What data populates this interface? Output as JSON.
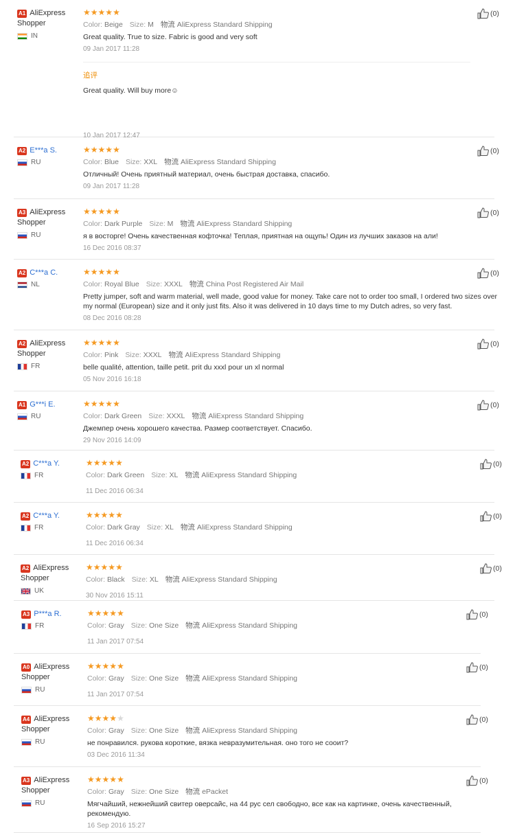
{
  "labels": {
    "color": "Color:",
    "size": "Size:",
    "shipping": "物流",
    "followup": "追评"
  },
  "icons": {
    "star": "star-icon",
    "thumb": "thumbs-up-icon",
    "flag": "flag-icon"
  },
  "colors": {
    "star": "#f59a23",
    "badge": "#d9361e",
    "masked_name": "#2d6fd2",
    "followup": "#ee8b00"
  },
  "reviews": [
    {
      "level": "A1",
      "name": "AliExpress Shopper",
      "masked": false,
      "country": "IN",
      "stars": 5,
      "color": "Beige",
      "size": "M",
      "shipping": "AliExpress Standard Shipping",
      "text": "Great quality. True to size. Fabric is good and very soft",
      "date": "09 Jan 2017 11:28",
      "helpful": "(0)",
      "followup": {
        "text": "Great quality. Will buy more☺",
        "date": "10 Jan 2017 12:47"
      }
    },
    {
      "level": "A2",
      "name": "E***a S.",
      "masked": true,
      "country": "RU",
      "stars": 5,
      "color": "Blue",
      "size": "XXL",
      "shipping": "AliExpress Standard Shipping",
      "text": "Отличный! Очень приятный материал, очень быстрая доставка, спасибо.",
      "date": "09 Jan 2017 11:28",
      "helpful": "(0)"
    },
    {
      "level": "A3",
      "name": "AliExpress Shopper",
      "masked": false,
      "country": "RU",
      "stars": 5,
      "color": "Dark Purple",
      "size": "M",
      "shipping": "AliExpress Standard Shipping",
      "text": "я в восторге! Очень качественная кофточка! Теплая, приятная на ощупь! Один из лучших заказов на али!",
      "date": "16 Dec 2016 08:37",
      "helpful": "(0)"
    },
    {
      "level": "A2",
      "name": "C***a C.",
      "masked": true,
      "country": "NL",
      "stars": 5,
      "color": "Royal Blue",
      "size": "XXXL",
      "shipping": "China Post Registered Air Mail",
      "text": "Pretty jumper, soft and warm material, well made, good value for money. Take care not to order too small, I ordered two sizes over my normal (European) size and it only just fits. Also it was delivered in 10 days time to my Dutch adres, so very fast.",
      "date": "08 Dec 2016 08:28",
      "helpful": "(0)"
    },
    {
      "level": "A2",
      "name": "AliExpress Shopper",
      "masked": false,
      "country": "FR",
      "stars": 5,
      "color": "Pink",
      "size": "XXXL",
      "shipping": "AliExpress Standard Shipping",
      "text": "belle qualité, attention, taille petit. prit du xxxl pour un xl normal",
      "date": "05 Nov 2016 16:18",
      "helpful": "(0)"
    },
    {
      "level": "A1",
      "name": "G***i E.",
      "masked": true,
      "country": "RU",
      "stars": 5,
      "color": "Dark Green",
      "size": "XXXL",
      "shipping": "AliExpress Standard Shipping",
      "text": "Джемпер очень хорошего качества. Размер соответствует. Спасибо.",
      "date": "29 Nov 2016 14:09",
      "helpful": "(0)"
    },
    {
      "level": "A2",
      "name": "C***a Y.",
      "masked": true,
      "country": "FR",
      "stars": 5,
      "color": "Dark Green",
      "size": "XL",
      "shipping": "AliExpress Standard Shipping",
      "text": "",
      "date": "11 Dec 2016 06:34",
      "helpful": "(0)"
    },
    {
      "level": "A2",
      "name": "C***a Y.",
      "masked": true,
      "country": "FR",
      "stars": 5,
      "color": "Dark Gray",
      "size": "XL",
      "shipping": "AliExpress Standard Shipping",
      "text": "",
      "date": "11 Dec 2016 06:34",
      "helpful": "(0)"
    },
    {
      "level": "A2",
      "name": "AliExpress Shopper",
      "masked": false,
      "country": "UK",
      "stars": 5,
      "color": "Black",
      "size": "XL",
      "shipping": "AliExpress Standard Shipping",
      "text": "",
      "date": "30 Nov 2016 15:11",
      "helpful": "(0)"
    },
    {
      "level": "A3",
      "name": "P***a R.",
      "masked": true,
      "country": "FR",
      "stars": 5,
      "color": "Gray",
      "size": "One Size",
      "shipping": "AliExpress Standard Shipping",
      "text": "",
      "date": "11 Jan 2017 07:54",
      "helpful": "(0)"
    },
    {
      "level": "A0",
      "name": "AliExpress Shopper",
      "masked": false,
      "country": "RU",
      "stars": 5,
      "color": "Gray",
      "size": "One Size",
      "shipping": "AliExpress Standard Shipping",
      "text": "",
      "date": "11 Jan 2017 07:54",
      "helpful": "(0)"
    },
    {
      "level": "A4",
      "name": "AliExpress Shopper",
      "masked": false,
      "country": "RU",
      "stars": 4,
      "color": "Gray",
      "size": "One Size",
      "shipping": "AliExpress Standard Shipping",
      "text": "не понравился. рукова короткие, вязка невразумительная. оно того не соoит?",
      "date": "03 Dec 2016 11:34",
      "helpful": "(0)"
    },
    {
      "level": "A3",
      "name": "AliExpress Shopper",
      "masked": false,
      "country": "RU",
      "stars": 5,
      "color": "Gray",
      "size": "One Size",
      "shipping": "ePacket",
      "text": "Мягчайший, нежнейший свитер оверсайс, на 44 рус сел свободно, все как на картинке, очень качественный, рекомендую.",
      "date": "16 Sep 2016 15:27",
      "helpful": "(0)"
    }
  ]
}
